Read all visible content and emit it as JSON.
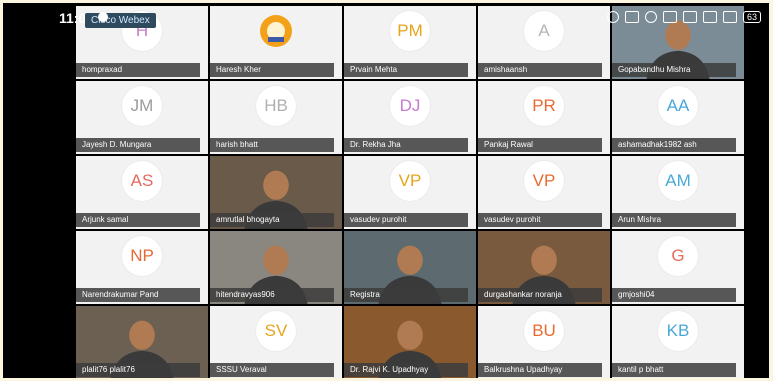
{
  "status_bar": {
    "time": "11:07",
    "app_name": "Cisco Webex",
    "battery": "63"
  },
  "participants": [
    {
      "name": "hompraxad",
      "initials": "H",
      "color": "#c77cc1",
      "type": "avatar"
    },
    {
      "name": "Haresh Kher",
      "initials": "",
      "color": "#e7871a",
      "type": "logo"
    },
    {
      "name": "Prvain Mehta",
      "initials": "PM",
      "color": "#e5a51b",
      "type": "avatar"
    },
    {
      "name": "amishaansh",
      "initials": "A",
      "color": "#b5b5b5",
      "type": "avatar"
    },
    {
      "name": "Gopabandhu Mishra",
      "initials": "",
      "color": "#7b8c96",
      "type": "video"
    },
    {
      "name": "Jayesh D. Mungara",
      "initials": "JM",
      "color": "#9b9b9b",
      "type": "avatar"
    },
    {
      "name": "harish bhatt",
      "initials": "HB",
      "color": "#b0b0b0",
      "type": "avatar"
    },
    {
      "name": "Dr. Rekha Jha",
      "initials": "DJ",
      "color": "#c97ad1",
      "type": "avatar"
    },
    {
      "name": "Pankaj Rawal",
      "initials": "PR",
      "color": "#e86a32",
      "type": "avatar"
    },
    {
      "name": "ashamadhak1982 ash",
      "initials": "AA",
      "color": "#4aa8d8",
      "type": "avatar"
    },
    {
      "name": "Arjunk samal",
      "initials": "AS",
      "color": "#e46b5d",
      "type": "avatar"
    },
    {
      "name": "amrutlal bhogayta",
      "initials": "",
      "color": "#6a5a4a",
      "type": "video"
    },
    {
      "name": "vasudev purohit",
      "initials": "VP",
      "color": "#e5a51b",
      "type": "avatar"
    },
    {
      "name": "vasudev purohit",
      "initials": "VP",
      "color": "#e86a32",
      "type": "avatar"
    },
    {
      "name": "Arun Mishra",
      "initials": "AM",
      "color": "#4aa8d8",
      "type": "avatar"
    },
    {
      "name": "Narendrakumar Pand",
      "initials": "NP",
      "color": "#e86a32",
      "type": "avatar"
    },
    {
      "name": "hitendravyas906",
      "initials": "",
      "color": "#8a8680",
      "type": "video"
    },
    {
      "name": "Registra",
      "initials": "",
      "color": "#5d6a6f",
      "type": "video"
    },
    {
      "name": "durgashankar noranja",
      "initials": "",
      "color": "#7a5a3e",
      "type": "video"
    },
    {
      "name": "gmjoshi04",
      "initials": "G",
      "color": "#e46b5d",
      "type": "avatar"
    },
    {
      "name": "plalit76 plalit76",
      "initials": "",
      "color": "#6b6052",
      "type": "video"
    },
    {
      "name": "SSSU Veraval",
      "initials": "SV",
      "color": "#e5a51b",
      "type": "avatar"
    },
    {
      "name": "Dr. Rajvi K. Upadhyay",
      "initials": "",
      "color": "#8a5a2e",
      "type": "video"
    },
    {
      "name": "Balkrushna Upadhyay",
      "initials": "BU",
      "color": "#e86a32",
      "type": "avatar"
    },
    {
      "name": "kantil p bhatt",
      "initials": "KB",
      "color": "#4aa8d8",
      "type": "avatar"
    }
  ]
}
